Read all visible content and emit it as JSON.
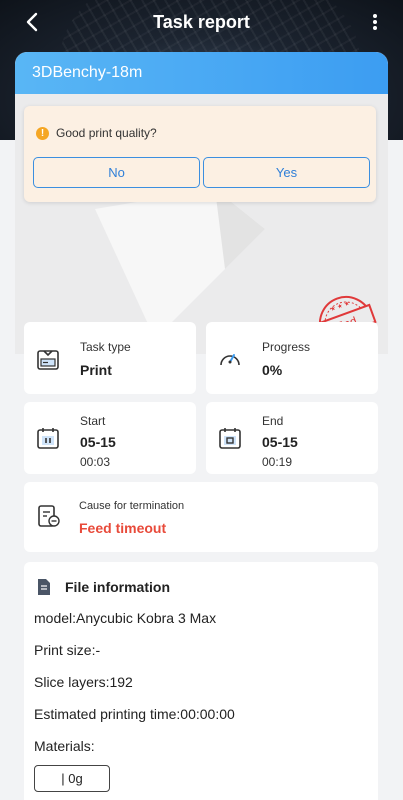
{
  "header": {
    "title": "Task report"
  },
  "card": {
    "title": "3DBenchy-18m"
  },
  "quality_prompt": {
    "question": "Good print quality?",
    "no_label": "No",
    "yes_label": "Yes"
  },
  "stamp": {
    "text": "End"
  },
  "task_type": {
    "label": "Task type",
    "value": "Print"
  },
  "progress": {
    "label": "Progress",
    "value": "0%"
  },
  "start": {
    "label": "Start",
    "date": "05-15",
    "time": "00:03"
  },
  "end": {
    "label": "End",
    "date": "05-15",
    "time": "00:19"
  },
  "termination": {
    "label": "Cause for termination",
    "value": "Feed timeout"
  },
  "file_info": {
    "title": "File information",
    "model": "model:Anycubic Kobra 3 Max",
    "print_size": "Print size:-",
    "slice_layers": "Slice layers:192",
    "est_time": "Estimated printing time:00:00:00",
    "materials_label": "Materials:",
    "material_chip": "| 0g"
  },
  "icons": {
    "back": "chevron-left-icon",
    "menu": "more-vertical-icon",
    "info": "info-icon",
    "task_type": "printer-icon",
    "progress": "gauge-icon",
    "start": "calendar-pause-icon",
    "end": "calendar-stop-icon",
    "termination": "document-minus-icon",
    "file": "file-icon"
  },
  "colors": {
    "accent": "#3c9df2",
    "header_gradient_start": "#59b6f5",
    "error": "#e84a3a",
    "stamp": "#e0393a",
    "prompt_bg": "#fcf0e3"
  }
}
